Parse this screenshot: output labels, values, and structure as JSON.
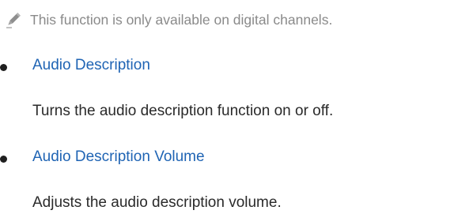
{
  "note": {
    "icon": "pencil-icon",
    "text": "This function is only available on digital channels."
  },
  "items": [
    {
      "title": "Audio Description",
      "description": "Turns the audio description function on or off."
    },
    {
      "title": "Audio Description Volume",
      "description": "Adjusts the audio description volume."
    }
  ],
  "colors": {
    "note_text": "#8a8a8a",
    "link_title": "#1f64b4",
    "body_text": "#2a2a2a",
    "bullet": "#1f1f1f"
  }
}
